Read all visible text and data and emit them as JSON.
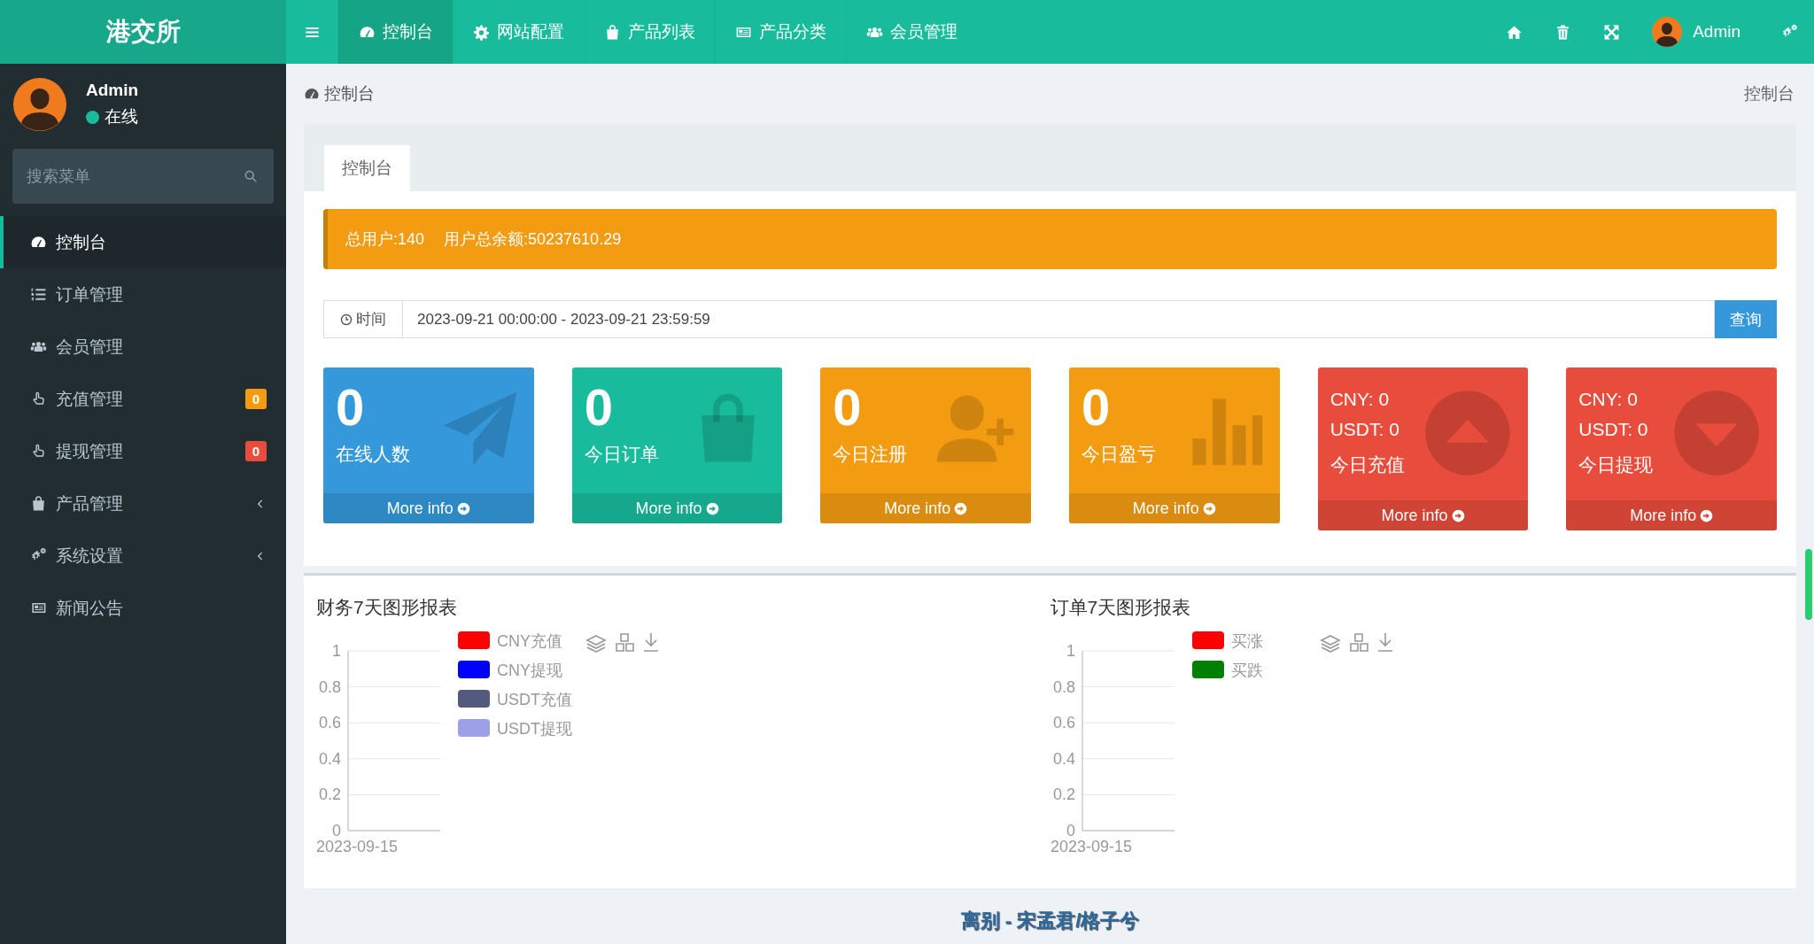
{
  "brand": "港交所",
  "top_nav": [
    {
      "label": "控制台",
      "selected": true
    },
    {
      "label": "网站配置",
      "selected": false
    },
    {
      "label": "产品列表",
      "selected": false
    },
    {
      "label": "产品分类",
      "selected": false
    },
    {
      "label": "会员管理",
      "selected": false
    }
  ],
  "header_user": {
    "name": "Admin"
  },
  "user_panel": {
    "name": "Admin",
    "status": "在线"
  },
  "sidebar_search": {
    "placeholder": "搜索菜单"
  },
  "sidebar": {
    "items": [
      {
        "label": "控制台",
        "selected": true
      },
      {
        "label": "订单管理",
        "selected": false
      },
      {
        "label": "会员管理",
        "selected": false
      },
      {
        "label": "充值管理",
        "selected": false,
        "badge": "0",
        "color": "#f39c12"
      },
      {
        "label": "提现管理",
        "selected": false,
        "badge": "0",
        "color": "#e74c3c"
      },
      {
        "label": "产品管理",
        "selected": false,
        "expanded": false
      },
      {
        "label": "系统设置",
        "selected": false,
        "expanded": false
      },
      {
        "label": "新闻公告",
        "selected": false
      }
    ]
  },
  "breadcrumb": {
    "title": "控制台",
    "current": "控制台"
  },
  "panel_tabs": [
    {
      "label": "控制台",
      "selected": true
    }
  ],
  "alert": {
    "total_users": "总用户:140",
    "total_balance": "用户总余额:50237610.29"
  },
  "date_filter": {
    "label": "时间",
    "value": "2023-09-21 00:00:00 - 2023-09-21 23:59:59",
    "button": "查询"
  },
  "stats": [
    {
      "kind": "count",
      "value": "0",
      "label": "在线人数",
      "link": "More info",
      "color": "#3498db"
    },
    {
      "kind": "count",
      "value": "0",
      "label": "今日订单",
      "link": "More info",
      "color": "#18bc9c"
    },
    {
      "kind": "count",
      "value": "0",
      "label": "今日注册",
      "link": "More info",
      "color": "#f39c12"
    },
    {
      "kind": "count",
      "value": "0",
      "label": "今日盈亏",
      "link": "More info",
      "color": "#f39c12"
    },
    {
      "kind": "currency",
      "lines": [
        {
          "label": "CNY:",
          "value": "0"
        },
        {
          "label": "USDT:",
          "value": "0"
        }
      ],
      "label": "今日充值",
      "link": "More info",
      "color": "#e74c3c"
    },
    {
      "kind": "currency",
      "lines": [
        {
          "label": "CNY:",
          "value": "0"
        },
        {
          "label": "USDT:",
          "value": "0"
        }
      ],
      "label": "今日提现",
      "link": "More info",
      "color": "#e74c3c"
    }
  ],
  "charts": [
    {
      "chart_data": {
        "type": "line",
        "grid": true,
        "title": "财务7天图形报表",
        "categories": [
          "2023-09-15"
        ],
        "ylim": [
          0,
          1
        ],
        "yticks": [
          0,
          0.2,
          0.4,
          0.6,
          0.8,
          1
        ],
        "series": [
          {
            "name": "CNY充值",
            "color": "#ff0000",
            "values": [
              null
            ]
          },
          {
            "name": "CNY提现",
            "color": "#0000ff",
            "values": [
              null
            ]
          },
          {
            "name": "USDT充值",
            "color": "#525a7e",
            "values": [
              null
            ]
          },
          {
            "name": "USDT提现",
            "color": "#9ca0e6",
            "values": [
              null
            ]
          }
        ]
      }
    },
    {
      "chart_data": {
        "type": "line",
        "grid": true,
        "title": "订单7天图形报表",
        "categories": [
          "2023-09-15"
        ],
        "ylim": [
          0,
          1
        ],
        "yticks": [
          0,
          0.2,
          0.4,
          0.6,
          0.8,
          1
        ],
        "series": [
          {
            "name": "买涨",
            "color": "#ff0000",
            "values": [
              null
            ]
          },
          {
            "name": "买跌",
            "color": "#008000",
            "values": [
              null
            ]
          }
        ]
      }
    }
  ],
  "footer": "离别 - 宋孟君/格子兮"
}
